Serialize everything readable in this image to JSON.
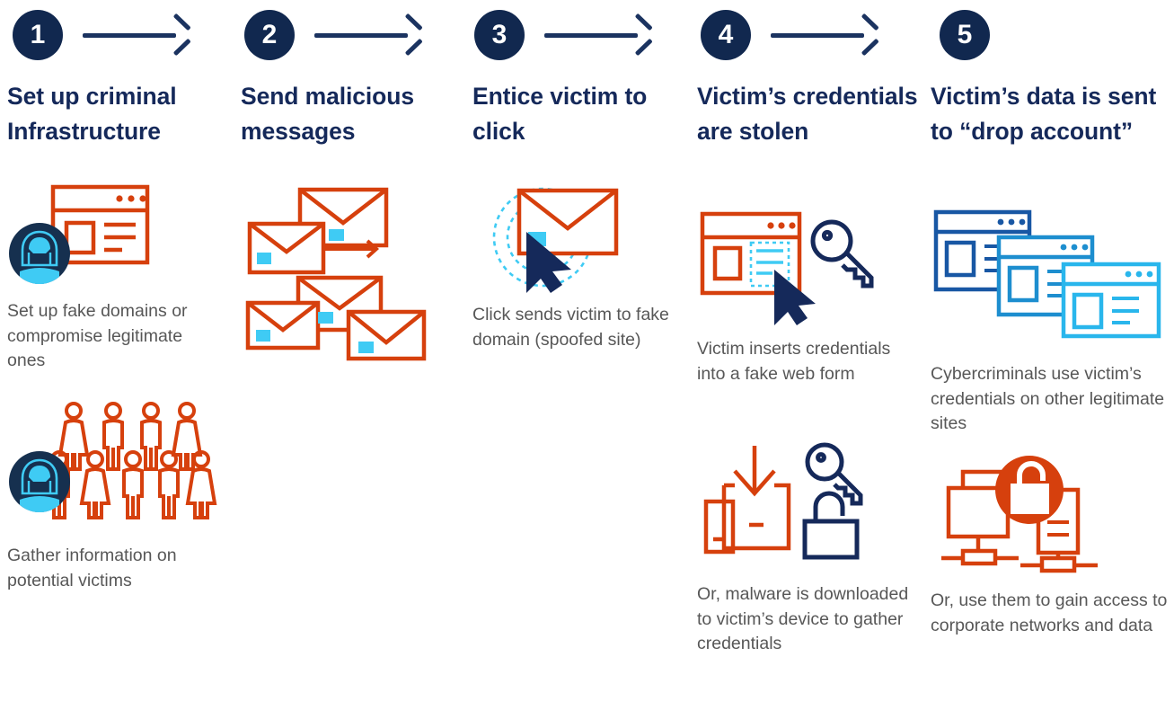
{
  "colors": {
    "navy": "#11284f",
    "navy_text": "#15295a",
    "body_text": "#575757",
    "orange": "#d6400d",
    "cyan": "#3fcbf4",
    "blue_dark": "#1857a4",
    "blue_mid": "#1d8ecf",
    "blue_light": "#29b6ec",
    "white": "#ffffff"
  },
  "steps": [
    {
      "number": "1",
      "heading": "Set up criminal Infrastructure",
      "has_arrow": true,
      "items": [
        {
          "icon": "hacker-browser-icon",
          "caption": "Set up fake domains or compromise legitimate ones"
        },
        {
          "icon": "hacker-crowd-icon",
          "caption": "Gather information on potential victims"
        }
      ]
    },
    {
      "number": "2",
      "heading": "Send malicious messages",
      "has_arrow": true,
      "items": [
        {
          "icon": "envelopes-icon",
          "caption": ""
        }
      ]
    },
    {
      "number": "3",
      "heading": "Entice victim to click",
      "has_arrow": true,
      "items": [
        {
          "icon": "envelope-cursor-icon",
          "caption": "Click sends victim to fake domain (spoofed site)"
        }
      ]
    },
    {
      "number": "4",
      "heading": "Victim’s credentials are stolen",
      "has_arrow": true,
      "items": [
        {
          "icon": "fake-web-form-key-icon",
          "caption": "Victim inserts credentials into a fake web form"
        },
        {
          "icon": "malware-download-icon",
          "caption": "Or, malware is downloaded to victim’s device to gather credentials"
        }
      ]
    },
    {
      "number": "5",
      "heading": "Victim’s data is sent to “drop account”",
      "has_arrow": false,
      "items": [
        {
          "icon": "browser-stack-icon",
          "caption": "Cybercriminals use victim’s credentials on other legitimate sites"
        },
        {
          "icon": "network-unlock-icon",
          "caption": "Or, use them to gain access to corporate networks and data"
        }
      ]
    }
  ]
}
